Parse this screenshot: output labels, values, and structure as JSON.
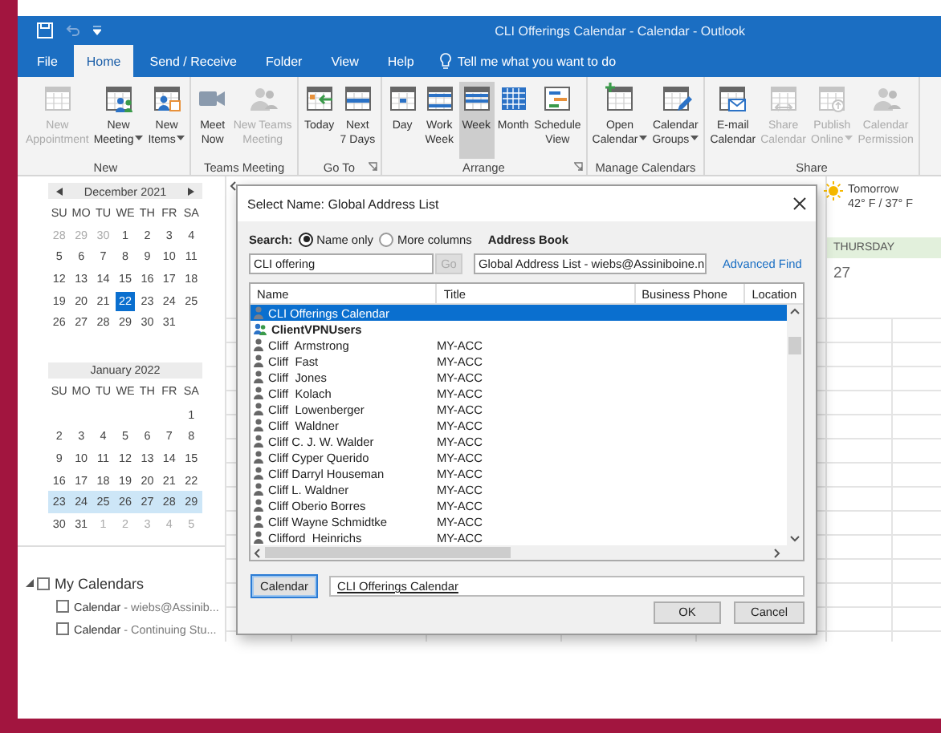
{
  "window": {
    "title": "CLI Offerings Calendar - Calendar -  Outlook"
  },
  "tabs": [
    {
      "label": "File",
      "selected": false
    },
    {
      "label": "Home",
      "selected": true
    },
    {
      "label": "Send / Receive",
      "selected": false
    },
    {
      "label": "Folder",
      "selected": false
    },
    {
      "label": "View",
      "selected": false
    },
    {
      "label": "Help",
      "selected": false
    }
  ],
  "tell_me": "Tell me what you want to do",
  "ribbon": {
    "groups": [
      {
        "label": "New",
        "launcher": false,
        "buttons": [
          {
            "label": "New\nAppointment",
            "disabled": true,
            "dropdown": false,
            "selected": false
          },
          {
            "label": "New\nMeeting",
            "disabled": false,
            "dropdown": true,
            "selected": false
          },
          {
            "label": "New\nItems",
            "disabled": false,
            "dropdown": true,
            "selected": false
          }
        ]
      },
      {
        "label": "Teams Meeting",
        "launcher": false,
        "buttons": [
          {
            "label": "Meet\nNow",
            "disabled": false,
            "dropdown": false,
            "selected": false
          },
          {
            "label": "New Teams\nMeeting",
            "disabled": true,
            "dropdown": false,
            "selected": false
          }
        ]
      },
      {
        "label": "Go To",
        "launcher": true,
        "buttons": [
          {
            "label": "Today",
            "disabled": false,
            "dropdown": false,
            "selected": false
          },
          {
            "label": "Next\n7 Days",
            "disabled": false,
            "dropdown": false,
            "selected": false
          }
        ]
      },
      {
        "label": "Arrange",
        "launcher": true,
        "buttons": [
          {
            "label": "Day",
            "disabled": false,
            "dropdown": false,
            "selected": false
          },
          {
            "label": "Work\nWeek",
            "disabled": false,
            "dropdown": false,
            "selected": false
          },
          {
            "label": "Week",
            "disabled": false,
            "dropdown": false,
            "selected": true
          },
          {
            "label": "Month",
            "disabled": false,
            "dropdown": false,
            "selected": false
          },
          {
            "label": "Schedule\nView",
            "disabled": false,
            "dropdown": false,
            "selected": false
          }
        ]
      },
      {
        "label": "Manage Calendars",
        "launcher": false,
        "buttons": [
          {
            "label": "Open\nCalendar",
            "disabled": false,
            "dropdown": true,
            "selected": false
          },
          {
            "label": "Calendar\nGroups",
            "disabled": false,
            "dropdown": true,
            "selected": false
          }
        ]
      },
      {
        "label": "Share",
        "launcher": false,
        "buttons": [
          {
            "label": "E-mail\nCalendar",
            "disabled": false,
            "dropdown": false,
            "selected": false
          },
          {
            "label": "Share\nCalendar",
            "disabled": true,
            "dropdown": false,
            "selected": false
          },
          {
            "label": "Publish\nOnline",
            "disabled": true,
            "dropdown": true,
            "selected": false
          },
          {
            "label": "Calendar\nPermission",
            "disabled": true,
            "dropdown": false,
            "selected": false
          }
        ]
      }
    ]
  },
  "date_navigator": {
    "months": [
      {
        "title": "December 2021",
        "weekdays": [
          "SU",
          "MO",
          "TU",
          "WE",
          "TH",
          "FR",
          "SA"
        ],
        "weeks": [
          {
            "selected": false,
            "days": [
              {
                "d": "28",
                "muted": true,
                "selected": false
              },
              {
                "d": "29",
                "muted": true,
                "selected": false
              },
              {
                "d": "30",
                "muted": true,
                "selected": false
              },
              {
                "d": "1",
                "muted": false,
                "selected": false
              },
              {
                "d": "2",
                "muted": false,
                "selected": false
              },
              {
                "d": "3",
                "muted": false,
                "selected": false
              },
              {
                "d": "4",
                "muted": false,
                "selected": false
              }
            ]
          },
          {
            "selected": false,
            "days": [
              {
                "d": "5",
                "muted": false,
                "selected": false
              },
              {
                "d": "6",
                "muted": false,
                "selected": false
              },
              {
                "d": "7",
                "muted": false,
                "selected": false
              },
              {
                "d": "8",
                "muted": false,
                "selected": false
              },
              {
                "d": "9",
                "muted": false,
                "selected": false
              },
              {
                "d": "10",
                "muted": false,
                "selected": false
              },
              {
                "d": "11",
                "muted": false,
                "selected": false
              }
            ]
          },
          {
            "selected": false,
            "days": [
              {
                "d": "12",
                "muted": false,
                "selected": false
              },
              {
                "d": "13",
                "muted": false,
                "selected": false
              },
              {
                "d": "14",
                "muted": false,
                "selected": false
              },
              {
                "d": "15",
                "muted": false,
                "selected": false
              },
              {
                "d": "16",
                "muted": false,
                "selected": false
              },
              {
                "d": "17",
                "muted": false,
                "selected": false
              },
              {
                "d": "18",
                "muted": false,
                "selected": false
              }
            ]
          },
          {
            "selected": false,
            "days": [
              {
                "d": "19",
                "muted": false,
                "selected": false
              },
              {
                "d": "20",
                "muted": false,
                "selected": false
              },
              {
                "d": "21",
                "muted": false,
                "selected": false
              },
              {
                "d": "22",
                "muted": false,
                "selected": true
              },
              {
                "d": "23",
                "muted": false,
                "selected": false
              },
              {
                "d": "24",
                "muted": false,
                "selected": false
              },
              {
                "d": "25",
                "muted": false,
                "selected": false
              }
            ]
          },
          {
            "selected": false,
            "days": [
              {
                "d": "26",
                "muted": false,
                "selected": false
              },
              {
                "d": "27",
                "muted": false,
                "selected": false
              },
              {
                "d": "28",
                "muted": false,
                "selected": false
              },
              {
                "d": "29",
                "muted": false,
                "selected": false
              },
              {
                "d": "30",
                "muted": false,
                "selected": false
              },
              {
                "d": "31",
                "muted": false,
                "selected": false
              },
              {
                "kind": "blank"
              }
            ]
          }
        ]
      },
      {
        "title": "January 2022",
        "weekdays": [
          "SU",
          "MO",
          "TU",
          "WE",
          "TH",
          "FR",
          "SA"
        ],
        "weeks": [
          {
            "selected": false,
            "days": [
              {
                "kind": "blank"
              },
              {
                "kind": "blank"
              },
              {
                "kind": "blank"
              },
              {
                "kind": "blank"
              },
              {
                "kind": "blank"
              },
              {
                "kind": "blank"
              },
              {
                "d": "1",
                "muted": false,
                "selected": false
              }
            ]
          },
          {
            "selected": false,
            "days": [
              {
                "d": "2",
                "muted": false,
                "selected": false
              },
              {
                "d": "3",
                "muted": false,
                "selected": false
              },
              {
                "d": "4",
                "muted": false,
                "selected": false
              },
              {
                "d": "5",
                "muted": false,
                "selected": false
              },
              {
                "d": "6",
                "muted": false,
                "selected": false
              },
              {
                "d": "7",
                "muted": false,
                "selected": false
              },
              {
                "d": "8",
                "muted": false,
                "selected": false
              }
            ]
          },
          {
            "selected": false,
            "days": [
              {
                "d": "9",
                "muted": false,
                "selected": false
              },
              {
                "d": "10",
                "muted": false,
                "selected": false
              },
              {
                "d": "11",
                "muted": false,
                "selected": false
              },
              {
                "d": "12",
                "muted": false,
                "selected": false
              },
              {
                "d": "13",
                "muted": false,
                "selected": false
              },
              {
                "d": "14",
                "muted": false,
                "selected": false
              },
              {
                "d": "15",
                "muted": false,
                "selected": false
              }
            ]
          },
          {
            "selected": false,
            "days": [
              {
                "d": "16",
                "muted": false,
                "selected": false
              },
              {
                "d": "17",
                "muted": false,
                "selected": false
              },
              {
                "d": "18",
                "muted": false,
                "selected": false
              },
              {
                "d": "19",
                "muted": false,
                "selected": false
              },
              {
                "d": "20",
                "muted": false,
                "selected": false
              },
              {
                "d": "21",
                "muted": false,
                "selected": false
              },
              {
                "d": "22",
                "muted": false,
                "selected": false
              }
            ]
          },
          {
            "selected": true,
            "days": [
              {
                "d": "23",
                "muted": false,
                "selected": false
              },
              {
                "d": "24",
                "muted": false,
                "selected": false
              },
              {
                "d": "25",
                "muted": false,
                "selected": false
              },
              {
                "d": "26",
                "muted": false,
                "selected": false
              },
              {
                "d": "27",
                "muted": false,
                "selected": false
              },
              {
                "d": "28",
                "muted": false,
                "selected": false
              },
              {
                "d": "29",
                "muted": false,
                "selected": false
              }
            ]
          },
          {
            "selected": false,
            "days": [
              {
                "d": "30",
                "muted": false,
                "selected": false
              },
              {
                "d": "31",
                "muted": false,
                "selected": false
              },
              {
                "d": "1",
                "muted": true,
                "selected": false
              },
              {
                "d": "2",
                "muted": true,
                "selected": false
              },
              {
                "d": "3",
                "muted": true,
                "selected": false
              },
              {
                "d": "4",
                "muted": true,
                "selected": false
              },
              {
                "d": "5",
                "muted": true,
                "selected": false
              }
            ]
          }
        ]
      }
    ]
  },
  "my_calendars": {
    "label": "My Calendars",
    "expanded": true,
    "checked": false,
    "items": [
      {
        "name": "Calendar",
        "account": "- wiebs@Assinib...",
        "checked": false
      },
      {
        "name": "Calendar",
        "account": "- Continuing Stu...",
        "checked": false
      }
    ]
  },
  "calendar_view": {
    "weather": {
      "day": "Tomorrow",
      "temps": "42° F / 37° F"
    },
    "day_header": "THURSDAY",
    "date": "27"
  },
  "dialog": {
    "title": "Select Name: Global Address List",
    "search_label": "Search:",
    "search_modes": [
      {
        "label": "Name only",
        "selected": true
      },
      {
        "label": "More columns",
        "selected": false
      }
    ],
    "address_book_label": "Address Book",
    "query": "CLI offering",
    "go": {
      "label": "Go",
      "disabled": true
    },
    "address_book": "Global Address List - wiebs@Assiniboine.n",
    "advanced_find": "Advanced Find",
    "columns": [
      "Name",
      "Title",
      "Business Phone",
      "Location"
    ],
    "rows": [
      {
        "kind": "contact",
        "name": "CLI Offerings Calendar",
        "selected": true
      },
      {
        "kind": "group",
        "name": "ClientVPNUsers",
        "selected": false
      },
      {
        "kind": "contact",
        "name": "Cliff  Armstrong",
        "title": "MY-ACC",
        "selected": false
      },
      {
        "kind": "contact",
        "name": "Cliff  Fast",
        "title": "MY-ACC",
        "selected": false
      },
      {
        "kind": "contact",
        "name": "Cliff  Jones",
        "title": "MY-ACC",
        "selected": false
      },
      {
        "kind": "contact",
        "name": "Cliff  Kolach",
        "title": "MY-ACC",
        "selected": false
      },
      {
        "kind": "contact",
        "name": "Cliff  Lowenberger",
        "title": "MY-ACC",
        "selected": false
      },
      {
        "kind": "contact",
        "name": "Cliff  Waldner",
        "title": "MY-ACC",
        "selected": false
      },
      {
        "kind": "contact",
        "name": "Cliff C. J. W. Walder",
        "title": "MY-ACC",
        "selected": false
      },
      {
        "kind": "contact",
        "name": "Cliff Cyper Querido",
        "title": "MY-ACC",
        "selected": false
      },
      {
        "kind": "contact",
        "name": "Cliff Darryl Houseman",
        "title": "MY-ACC",
        "selected": false
      },
      {
        "kind": "contact",
        "name": "Cliff L. Waldner",
        "title": "MY-ACC",
        "selected": false
      },
      {
        "kind": "contact",
        "name": "Cliff Oberio Borres",
        "title": "MY-ACC",
        "selected": false
      },
      {
        "kind": "contact",
        "name": "Cliff Wayne Schmidtke",
        "title": "MY-ACC",
        "selected": false
      },
      {
        "kind": "contact",
        "name": "Clifford  Heinrichs",
        "title": "MY-ACC",
        "selected": false
      }
    ],
    "recipient_button": "Calendar",
    "recipient_value": "CLI Offerings Calendar",
    "buttons": [
      "OK",
      "Cancel"
    ]
  }
}
